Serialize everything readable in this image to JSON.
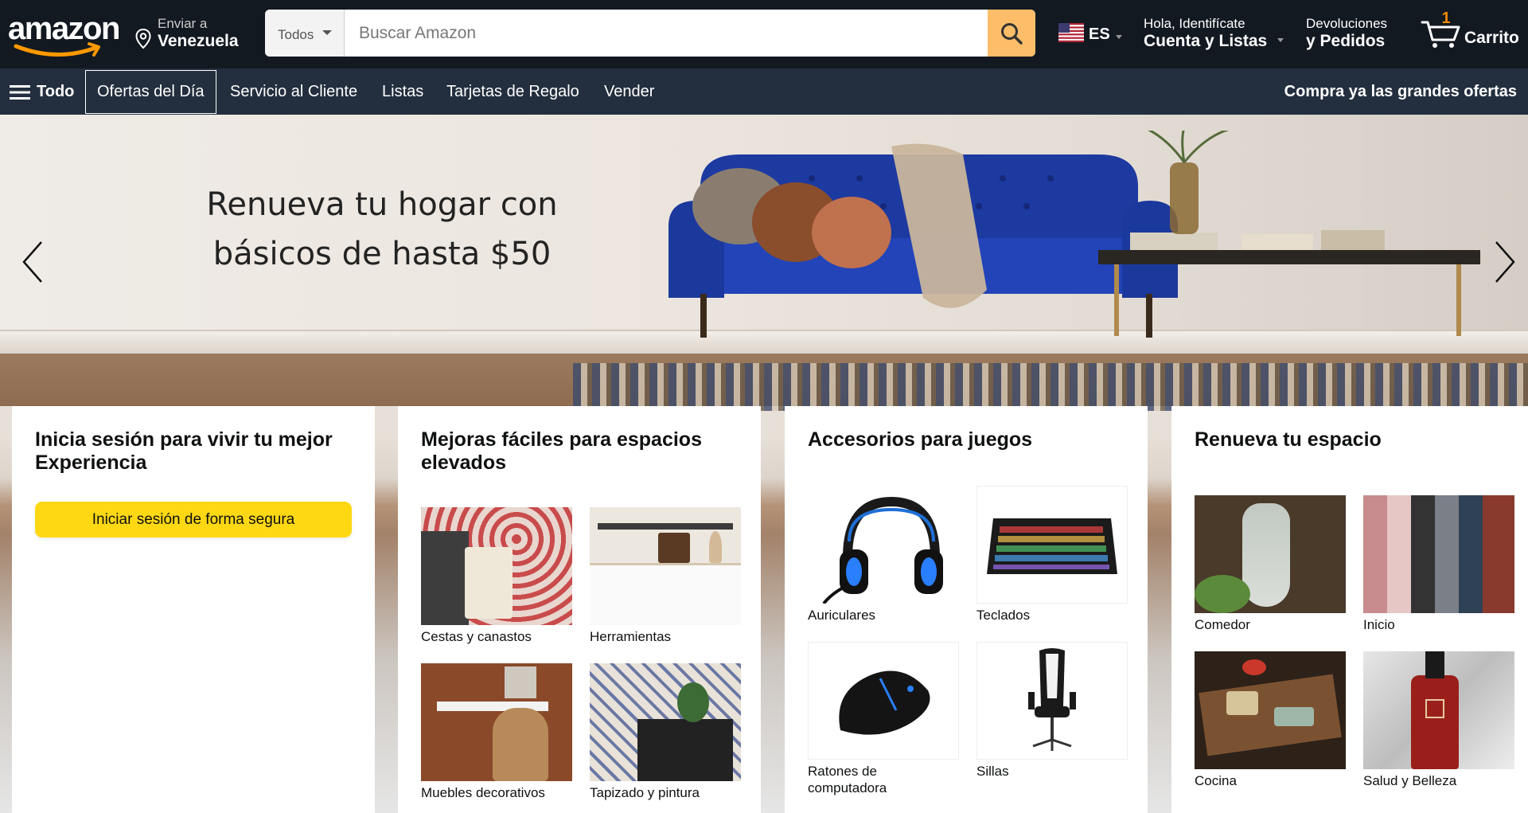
{
  "header": {
    "logo_text": "amazon",
    "deliver_line1": "Enviar a",
    "deliver_line2": "Venezuela",
    "search_category": "Todos",
    "search_placeholder": "Buscar Amazon",
    "language_code": "ES",
    "account_line1": "Hola, Identifícate",
    "account_line2": "Cuenta y Listas",
    "returns_line1": "Devoluciones",
    "returns_line2": "y Pedidos",
    "cart_count": "1",
    "cart_label": "Carrito",
    "brand_orange": "#febd69"
  },
  "subnav": {
    "all_label": "Todo",
    "items": [
      "Ofertas del Día",
      "Servicio al Cliente",
      "Listas",
      "Tarjetas de Regalo",
      "Vender"
    ],
    "promo": "Compra ya las grandes ofertas"
  },
  "hero": {
    "headline_line1": "Renueva tu hogar con",
    "headline_line2": "básicos de hasta $50"
  },
  "cards": {
    "signin": {
      "title": "Inicia sesión para vivir tu mejor Experiencia",
      "button": "Iniciar sesión de forma segura"
    },
    "upgrades": {
      "title": "Mejoras fáciles para espacios elevados",
      "tiles": [
        "Cestas y canastos",
        "Herramientas",
        "Muebles decorativos",
        "Tapizado y pintura"
      ]
    },
    "gaming": {
      "title": "Accesorios para juegos",
      "tiles": [
        "Auriculares",
        "Teclados",
        "Ratones de computadora",
        "Sillas"
      ]
    },
    "refresh": {
      "title": "Renueva tu espacio",
      "tiles": [
        "Comedor",
        "Inicio",
        "Cocina",
        "Salud y Belleza"
      ]
    }
  }
}
